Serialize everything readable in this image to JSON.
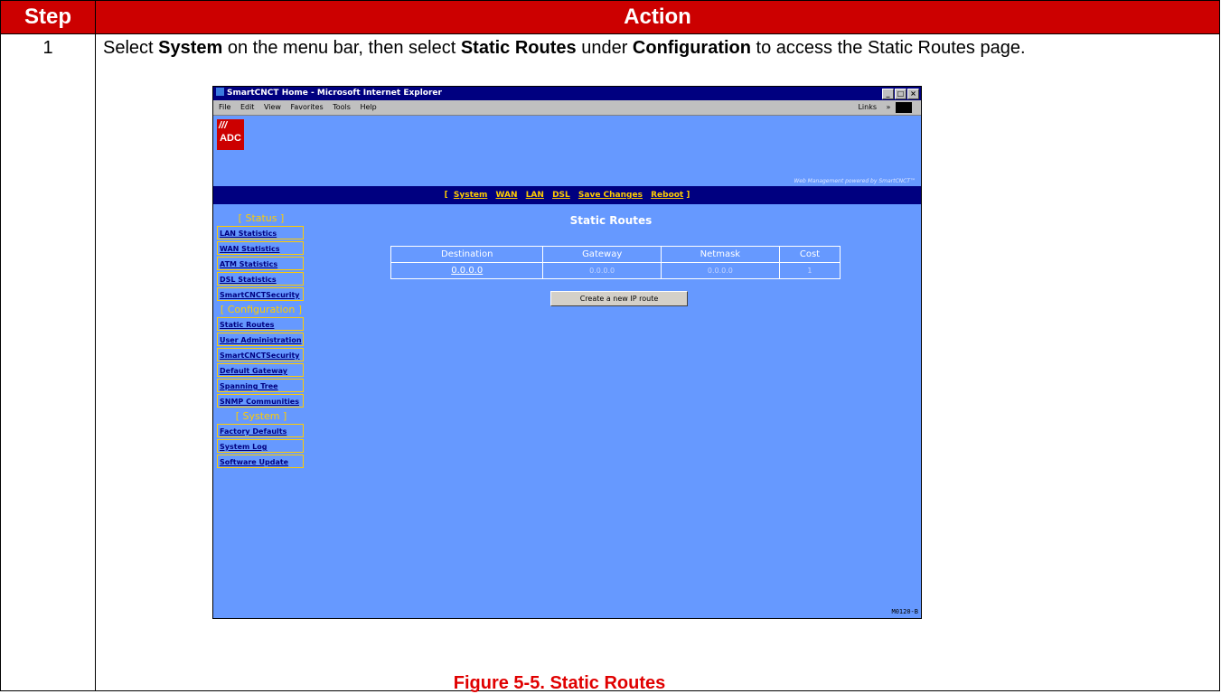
{
  "table": {
    "step_header": "Step",
    "action_header": "Action"
  },
  "step": {
    "number": "1",
    "instruction": {
      "t1": "Select ",
      "b1": "System",
      "t2": " on the menu bar, then select ",
      "b2": "Static Routes",
      "t3": " under ",
      "b3": "Configuration",
      "t4": " to access the Static Routes page."
    }
  },
  "browser": {
    "title": "SmartCNCT Home - Microsoft Internet Explorer",
    "menu": [
      "File",
      "Edit",
      "View",
      "Favorites",
      "Tools",
      "Help"
    ],
    "links_label": "Links",
    "logo_text": "ADC",
    "logo_marks": "///",
    "powered_by": "Web Management powered by SmartCNCT™",
    "nav": [
      "System",
      "WAN",
      "LAN",
      "DSL",
      "Save Changes",
      "Reboot"
    ],
    "sidebar": {
      "status_label": "[ Status ]",
      "status_items": [
        "LAN Statistics",
        "WAN Statistics",
        "ATM Statistics",
        "DSL Statistics",
        "SmartCNCTSecurity"
      ],
      "config_label": "[ Configuration ]",
      "config_items": [
        "Static Routes",
        "User Administration",
        "SmartCNCTSecurity",
        "Default Gateway",
        "Spanning Tree",
        "SNMP Communities"
      ],
      "system_label": "[ System ]",
      "system_items": [
        "Factory Defaults",
        "System Log",
        "Software Update"
      ]
    },
    "page_title": "Static Routes",
    "routes": {
      "columns": [
        "Destination",
        "Gateway",
        "Netmask",
        "Cost"
      ],
      "rows": [
        {
          "destination": "0.0.0.0",
          "gateway": "0.0.0.0",
          "netmask": "0.0.0.0",
          "cost": "1"
        }
      ]
    },
    "create_button": "Create a new IP route",
    "code": "M0120-B"
  },
  "caption": "Figure 5-5. Static Routes"
}
